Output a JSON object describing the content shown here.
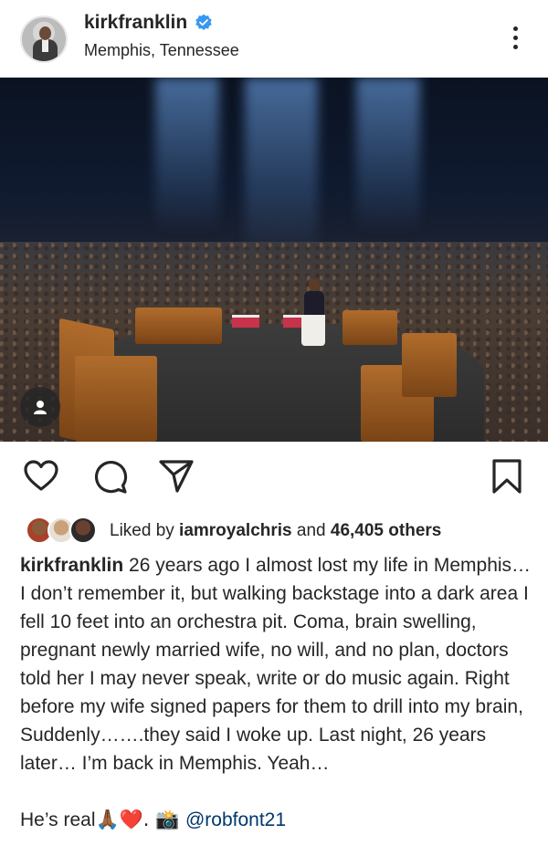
{
  "post": {
    "username": "kirkfranklin",
    "location": "Memphis, Tennessee",
    "verified": true
  },
  "likes": {
    "prefix": "Liked by ",
    "liked_by_user": "iamroyalchris",
    "middle": " and ",
    "others": "46,405 others"
  },
  "caption": {
    "username": "kirkfranklin",
    "text": " 26 years ago I almost lost my life in Memphis… I don’t remember it, but walking backstage into a dark area I fell 10 feet into an orchestra pit. Coma, brain swelling, pregnant newly married wife, no will, and no plan, doctors told her I may never speak, write or do music again. Right before my wife signed papers for them to drill into my brain, Suddenly…….they said I woke up. Last night, 26 years later… I’m back in Memphis. Yeah…",
    "line2_prefix": "He’s real",
    "line2_emojis": "🙏🏾❤️. 📸 ",
    "mention": "@robfont21"
  },
  "icons": {
    "verified": "verified-badge-icon",
    "more": "more-vertical-icon",
    "tag": "user-tag-icon",
    "like": "heart-icon",
    "comment": "comment-icon",
    "share": "send-icon",
    "save": "bookmark-icon"
  },
  "colors": {
    "verified_blue": "#3897f0",
    "text": "#262626",
    "mention": "#00376b"
  }
}
